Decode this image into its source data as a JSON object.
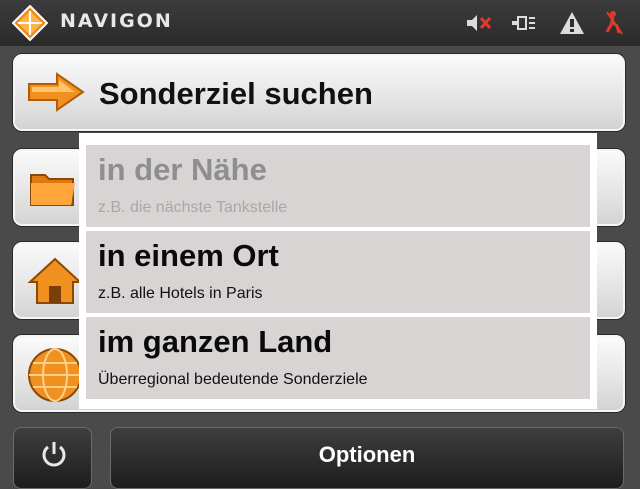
{
  "header": {
    "brand": "NAVIGON",
    "status_icons": [
      "mute-icon",
      "battery-icon",
      "warning-icon",
      "gps-off-icon"
    ]
  },
  "menu": {
    "main_label": "Sonderziel suchen",
    "background_buttons": [
      "folder-icon",
      "home-icon",
      "globe-icon"
    ]
  },
  "popup": {
    "items": [
      {
        "title": "in der Nähe",
        "subtitle": "z.B. die nächste Tankstelle",
        "enabled": false
      },
      {
        "title": "in einem Ort",
        "subtitle": "z.B. alle Hotels in Paris",
        "enabled": true
      },
      {
        "title": "im ganzen Land",
        "subtitle": "Überregional bedeutende Sonderziele",
        "enabled": true
      }
    ]
  },
  "footer": {
    "options_label": "Optionen"
  },
  "colors": {
    "accent": "#f0901e",
    "item_bg": "#d7d4d3",
    "dark": "#2a2a2a"
  }
}
